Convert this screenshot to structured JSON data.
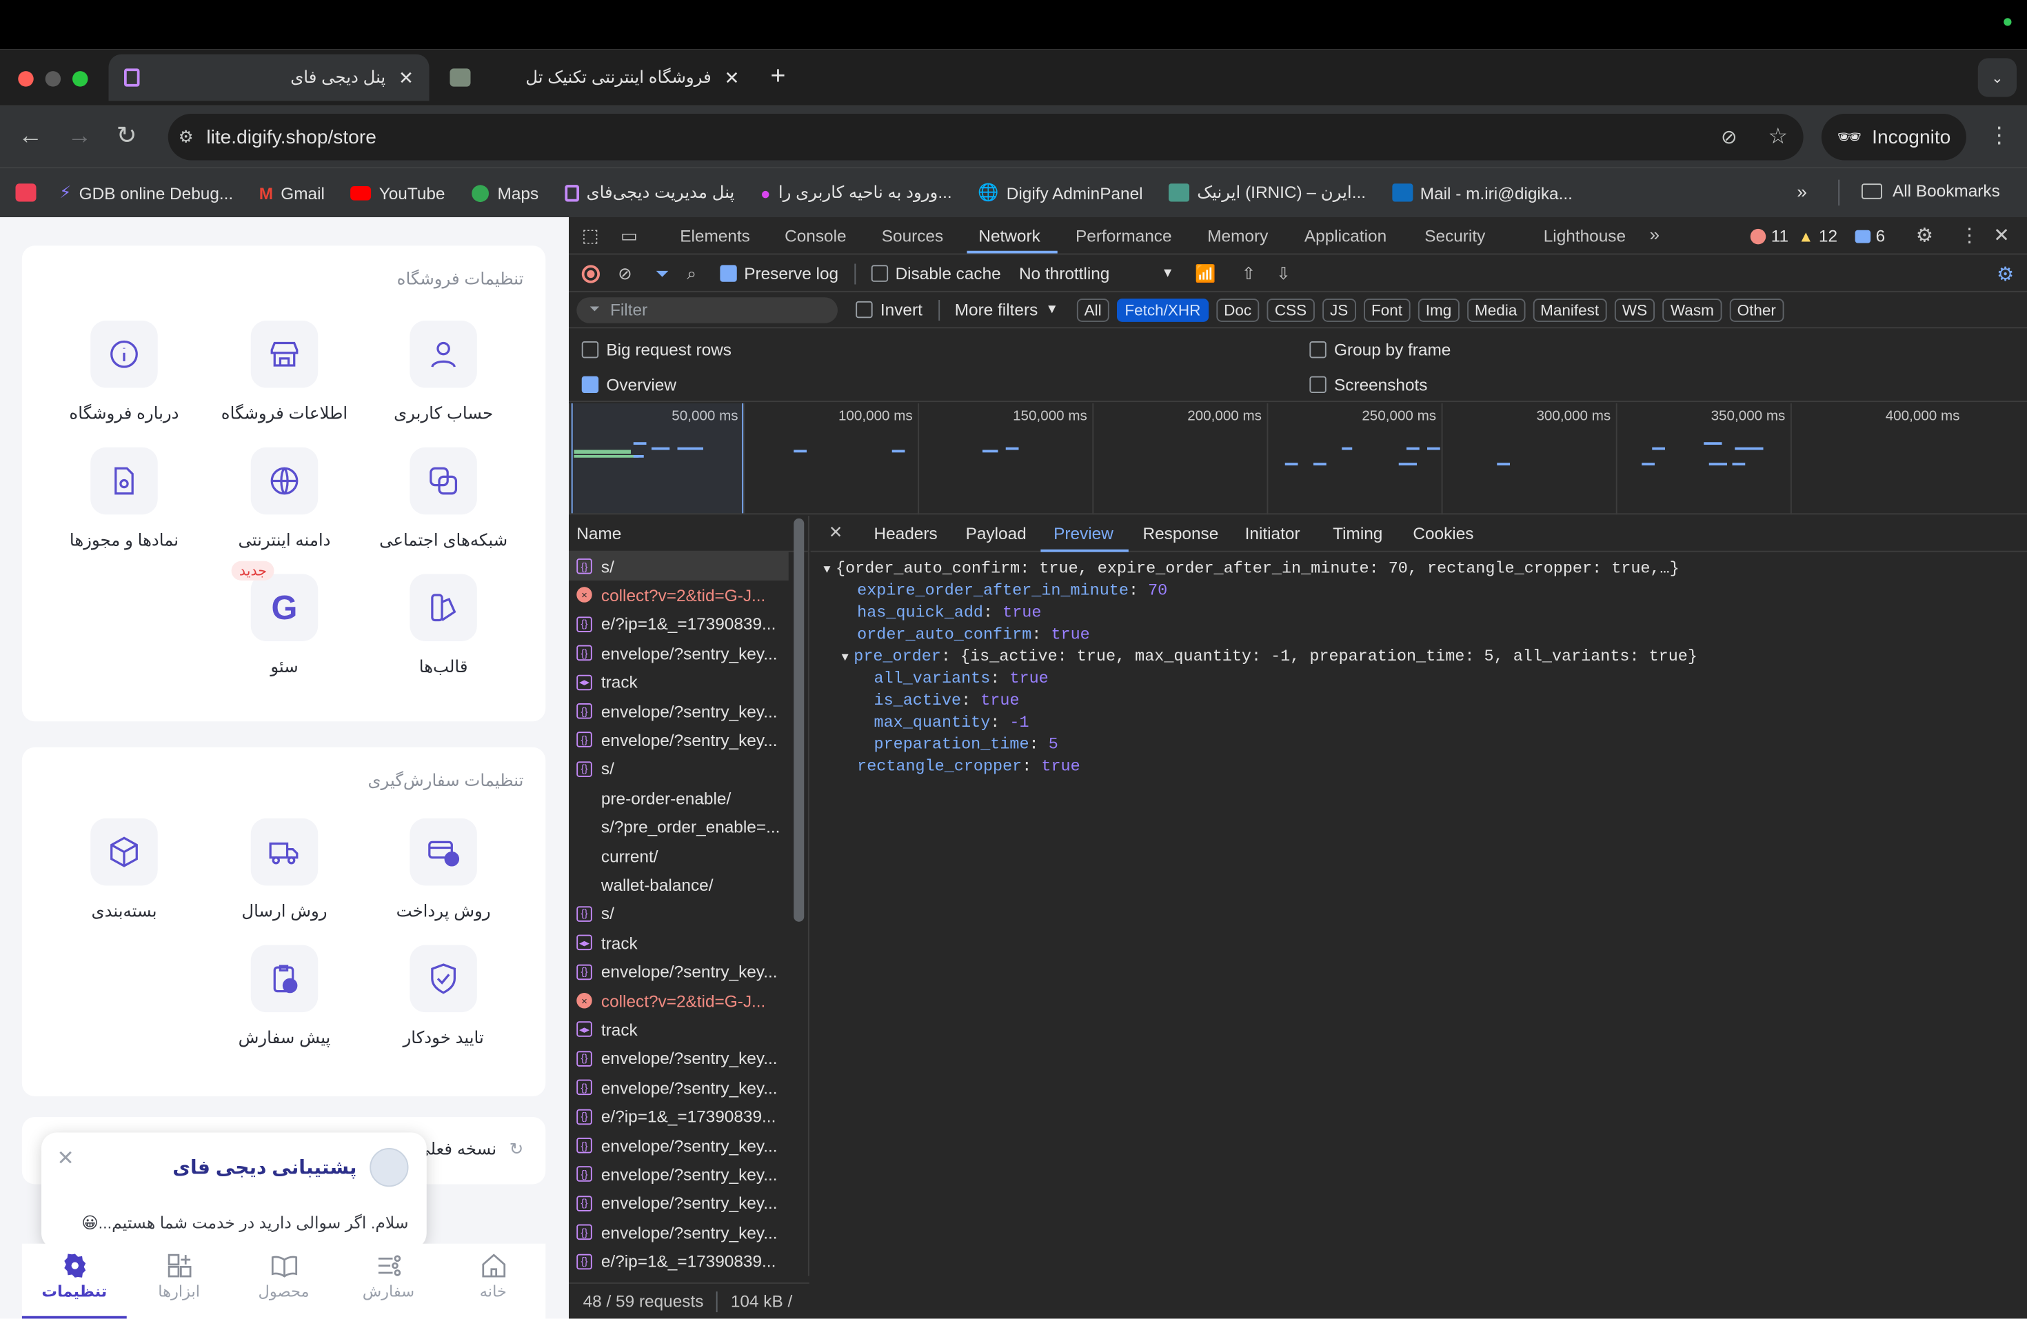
{
  "tabs": [
    {
      "title": "پنل دیجی فای",
      "active": true
    },
    {
      "title": "فروشگاه اینترنتی تکنیک تل",
      "active": false
    }
  ],
  "url": "lite.digify.shop/store",
  "incognito_label": "Incognito",
  "bookmarks": [
    {
      "icon": "dev-icon",
      "label": "GDB online Debug..."
    },
    {
      "icon": "gmail-icon",
      "label": "Gmail"
    },
    {
      "icon": "youtube-icon",
      "label": "YouTube"
    },
    {
      "icon": "maps-icon",
      "label": "Maps"
    },
    {
      "icon": "digify-icon",
      "label": "پنل مدیریت دیجی‌فای"
    },
    {
      "icon": "login-icon",
      "label": "ورود به ناحیه کاربری را..."
    },
    {
      "icon": "globe-icon",
      "label": "Digify AdminPanel"
    },
    {
      "icon": "irnic-icon",
      "label": "ایرنیک (IRNIC) – ایرن..."
    },
    {
      "icon": "outlook-icon",
      "label": "Mail - m.iri@digika..."
    }
  ],
  "all_bookmarks": "All Bookmarks",
  "store_settings": {
    "title": "تنظیمات فروشگاه",
    "items": [
      "حساب کاربری",
      "اطلاعات فروشگاه",
      "درباره فروشگاه",
      "شبکه‌های اجتماعی",
      "دامنه اینترنتی",
      "نمادها و مجوزها",
      "قالب‌ها",
      "سئو"
    ],
    "new_badge": "جدید"
  },
  "order_settings": {
    "title": "تنظیمات سفارش‌گیری",
    "items": [
      "روش پرداخت",
      "روش ارسال",
      "بسته‌بندی",
      "تایید خودکار",
      "پیش سفارش"
    ]
  },
  "version_card": "نسخه فعلی",
  "support": {
    "title": "پشتیبانی دیجی فای",
    "message": "سلام. اگر سوالی دارید در خدمت شما هستیم...😀"
  },
  "bottom_nav": [
    "خانه",
    "سفارش",
    "محصول",
    "ابزارها",
    "تنظیمات"
  ],
  "devtools": {
    "tabs": [
      "Elements",
      "Console",
      "Sources",
      "Network",
      "Performance",
      "Memory",
      "Application",
      "Security",
      "Lighthouse"
    ],
    "errors": "11",
    "warnings": "12",
    "messages": "6",
    "preserve_log": "Preserve log",
    "disable_cache": "Disable cache",
    "throttling": "No throttling",
    "filter_placeholder": "Filter",
    "invert": "Invert",
    "more_filters": "More filters",
    "type_filters": [
      "All",
      "Fetch/XHR",
      "Doc",
      "CSS",
      "JS",
      "Font",
      "Img",
      "Media",
      "Manifest",
      "WS",
      "Wasm",
      "Other"
    ],
    "options": [
      "Big request rows",
      "Group by frame",
      "Overview",
      "Screenshots"
    ],
    "timeline_ticks": [
      "50,000 ms",
      "100,000 ms",
      "150,000 ms",
      "200,000 ms",
      "250,000 ms",
      "300,000 ms",
      "350,000 ms",
      "400,000 ms"
    ],
    "name_header": "Name",
    "requests": [
      {
        "name": "s/",
        "type": "fetch"
      },
      {
        "name": "collect?v=2&tid=G-J...",
        "type": "error"
      },
      {
        "name": "e/?ip=1&_=17390839...",
        "type": "fetch"
      },
      {
        "name": "envelope/?sentry_key...",
        "type": "fetch"
      },
      {
        "name": "track",
        "type": "xhr"
      },
      {
        "name": "envelope/?sentry_key...",
        "type": "fetch"
      },
      {
        "name": "envelope/?sentry_key...",
        "type": "fetch"
      },
      {
        "name": "s/",
        "type": "fetch"
      },
      {
        "name": "pre-order-enable/",
        "type": "none"
      },
      {
        "name": "s/?pre_order_enable=...",
        "type": "none"
      },
      {
        "name": "current/",
        "type": "none"
      },
      {
        "name": "wallet-balance/",
        "type": "none"
      },
      {
        "name": "s/",
        "type": "fetch"
      },
      {
        "name": "track",
        "type": "xhr"
      },
      {
        "name": "envelope/?sentry_key...",
        "type": "fetch"
      },
      {
        "name": "collect?v=2&tid=G-J...",
        "type": "error"
      },
      {
        "name": "track",
        "type": "xhr"
      },
      {
        "name": "envelope/?sentry_key...",
        "type": "fetch"
      },
      {
        "name": "envelope/?sentry_key...",
        "type": "fetch"
      },
      {
        "name": "e/?ip=1&_=17390839...",
        "type": "fetch"
      },
      {
        "name": "envelope/?sentry_key...",
        "type": "fetch"
      },
      {
        "name": "envelope/?sentry_key...",
        "type": "fetch"
      },
      {
        "name": "envelope/?sentry_key...",
        "type": "fetch"
      },
      {
        "name": "envelope/?sentry_key...",
        "type": "fetch"
      },
      {
        "name": "e/?ip=1&_=17390839...",
        "type": "fetch"
      }
    ],
    "detail_tabs": [
      "Headers",
      "Payload",
      "Preview",
      "Response",
      "Initiator",
      "Timing",
      "Cookies"
    ],
    "preview": {
      "summary": "{order_auto_confirm: true, expire_order_after_in_minute: 70, rectangle_cropper: true,…}",
      "fields": [
        {
          "key": "expire_order_after_in_minute",
          "value": "70"
        },
        {
          "key": "has_quick_add",
          "value": "true"
        },
        {
          "key": "order_auto_confirm",
          "value": "true"
        }
      ],
      "pre_order_key": "pre_order",
      "pre_order_summary": "{is_active: true, max_quantity: -1, preparation_time: 5, all_variants: true}",
      "pre_order_fields": [
        {
          "key": "all_variants",
          "value": "true"
        },
        {
          "key": "is_active",
          "value": "true"
        },
        {
          "key": "max_quantity",
          "value": "-1"
        },
        {
          "key": "preparation_time",
          "value": "5"
        }
      ],
      "last_field": {
        "key": "rectangle_cropper",
        "value": "true"
      }
    },
    "status": "48 / 59 requests",
    "transferred": "104 kB /"
  }
}
